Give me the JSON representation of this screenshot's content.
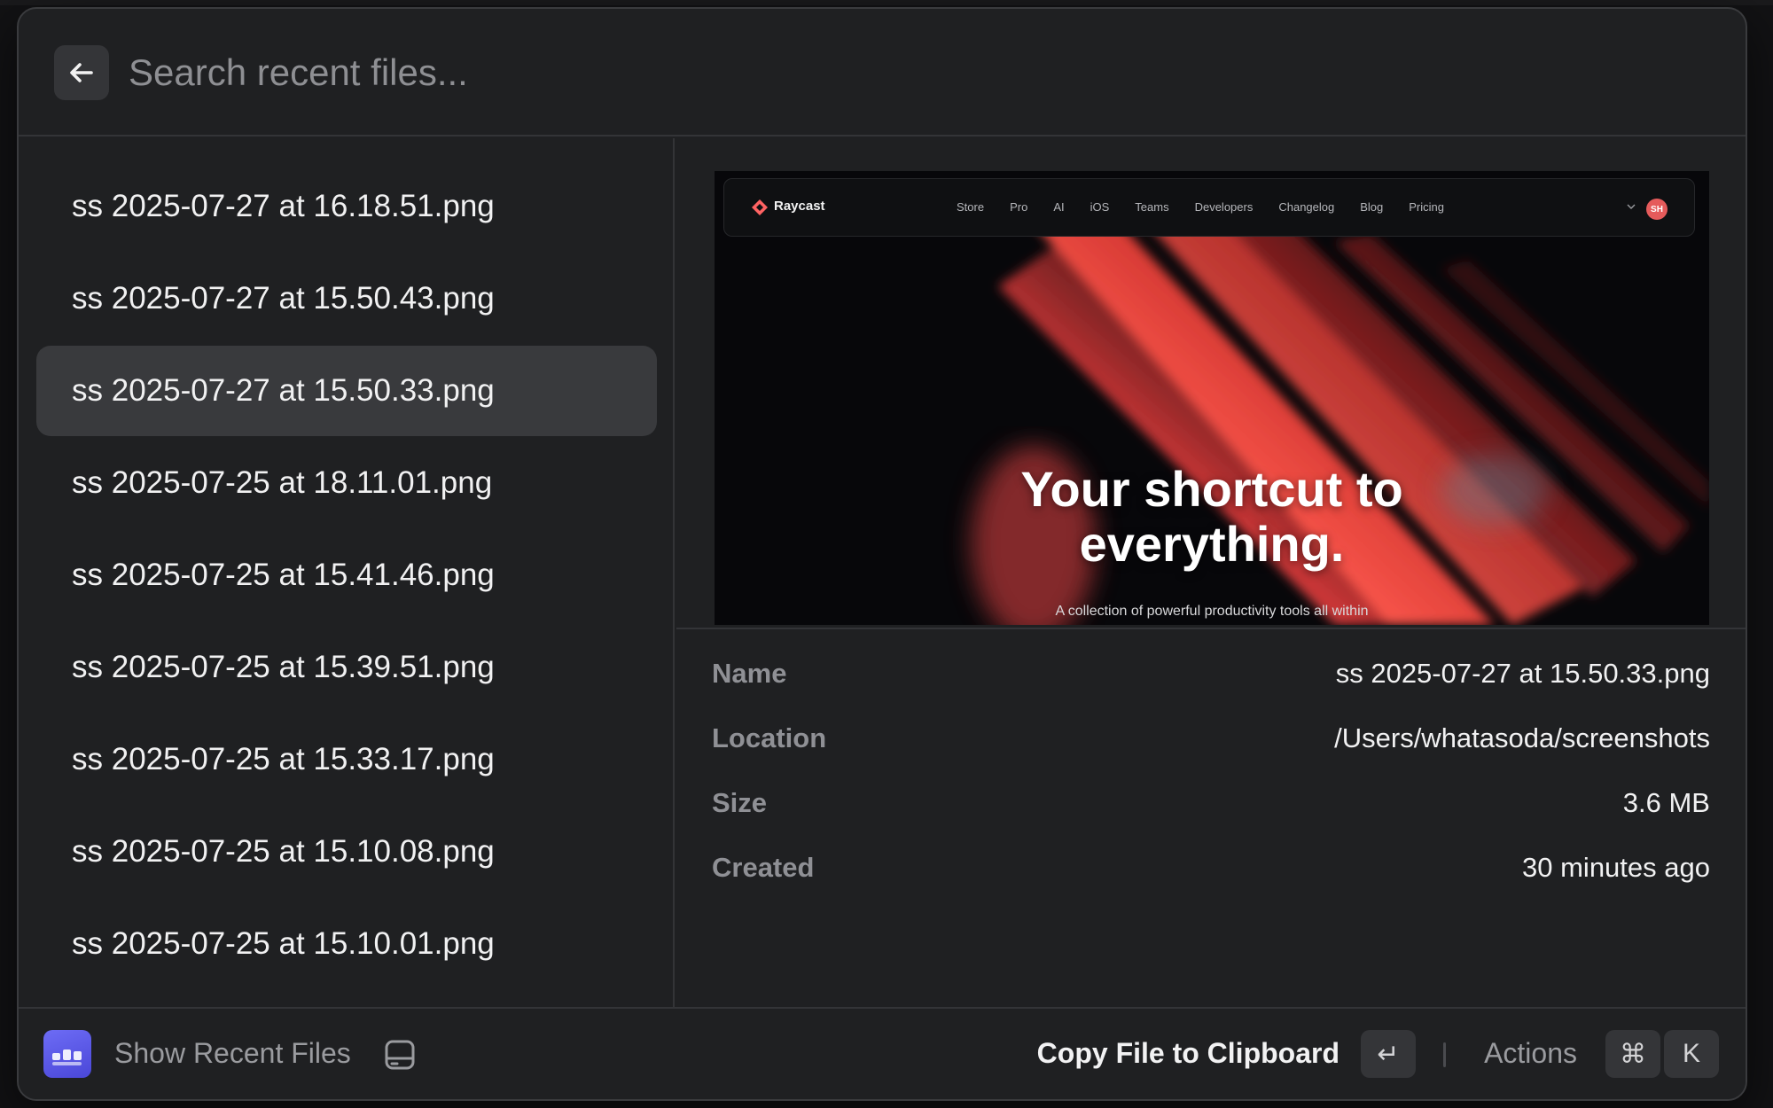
{
  "search": {
    "placeholder": "Search recent files...",
    "back_icon": "arrow-left-icon"
  },
  "files": [
    {
      "name": "ss 2025-07-27 at 16.18.51.png"
    },
    {
      "name": "ss 2025-07-27 at 15.50.43.png"
    },
    {
      "name": "ss 2025-07-27 at 15.50.33.png",
      "selected": true
    },
    {
      "name": "ss 2025-07-25 at 18.11.01.png"
    },
    {
      "name": "ss 2025-07-25 at 15.41.46.png"
    },
    {
      "name": "ss 2025-07-25 at 15.39.51.png"
    },
    {
      "name": "ss 2025-07-25 at 15.33.17.png"
    },
    {
      "name": "ss 2025-07-25 at 15.10.08.png"
    },
    {
      "name": "ss 2025-07-25 at 15.10.01.png"
    }
  ],
  "preview": {
    "brand": "Raycast",
    "nav_links": [
      "Store",
      "Pro",
      "AI",
      "iOS",
      "Teams",
      "Developers",
      "Changelog",
      "Blog",
      "Pricing"
    ],
    "avatar_initials": "SH",
    "headline_line1": "Your shortcut to",
    "headline_line2": "everything.",
    "subtext": "A collection of powerful productivity tools all within"
  },
  "metadata": {
    "name_label": "Name",
    "name_value": "ss 2025-07-27 at 15.50.33.png",
    "location_label": "Location",
    "location_value": "/Users/whatasoda/screenshots",
    "size_label": "Size",
    "size_value": "3.6 MB",
    "created_label": "Created",
    "created_value": "30 minutes ago"
  },
  "footer": {
    "command_title": "Show Recent Files",
    "primary_action": "Copy File to Clipboard",
    "enter_key": "↵",
    "actions_label": "Actions",
    "cmd_key": "⌘",
    "k_key": "K"
  },
  "colors": {
    "window_bg": "#1f2022",
    "selected_row": "#393a3d",
    "accent_red": "#ff6363",
    "app_icon": "#5b5af0"
  }
}
